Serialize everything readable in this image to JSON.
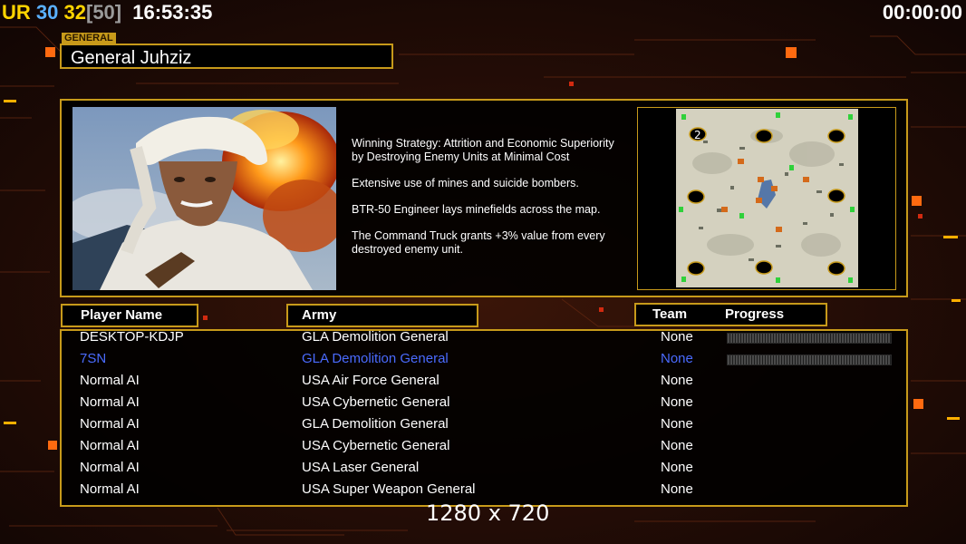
{
  "hud": {
    "ur_label": "UR",
    "fps_a": "30",
    "fps_b": "32",
    "fps_limit": "[50]",
    "clock": "16:53:35",
    "timer": "00:00:00"
  },
  "general": {
    "tag": "GENERAL",
    "name": "General Juhziz"
  },
  "description": [
    "Winning Strategy: Attrition and Economic Superiority\n by Destroying Enemy Units at Minimal Cost",
    "Extensive use of mines and suicide bombers.",
    "BTR-50 Engineer lays minefields across the map.",
    "The Command Truck grants +3% value from every\n destroyed enemy unit."
  ],
  "map": {
    "player_marker": "2"
  },
  "table": {
    "headers": {
      "player": "Player Name",
      "army": "Army",
      "team": "Team",
      "progress": "Progress"
    },
    "rows": [
      {
        "player": "DESKTOP-KDJP",
        "army": "GLA Demolition General",
        "team": "None",
        "progress_bar": true,
        "local": false
      },
      {
        "player": "7SN",
        "army": "GLA Demolition General",
        "team": "None",
        "progress_bar": true,
        "local": true
      },
      {
        "player": "Normal AI",
        "army": "USA Air Force General",
        "team": "None",
        "progress_bar": false,
        "local": false
      },
      {
        "player": "Normal AI",
        "army": "USA Cybernetic General",
        "team": "None",
        "progress_bar": false,
        "local": false
      },
      {
        "player": "Normal AI",
        "army": "GLA Demolition General",
        "team": "None",
        "progress_bar": false,
        "local": false
      },
      {
        "player": "Normal AI",
        "army": "USA Cybernetic General",
        "team": "None",
        "progress_bar": false,
        "local": false
      },
      {
        "player": "Normal AI",
        "army": "USA Laser General",
        "team": "None",
        "progress_bar": false,
        "local": false
      },
      {
        "player": "Normal AI",
        "army": "USA Super Weapon General",
        "team": "None",
        "progress_bar": false,
        "local": false
      }
    ]
  },
  "resolution_label": "1280 x 720",
  "colors": {
    "frame_gold": "#c79a1a",
    "local_player_blue": "#4a6bff",
    "background": "#1a0b06"
  }
}
